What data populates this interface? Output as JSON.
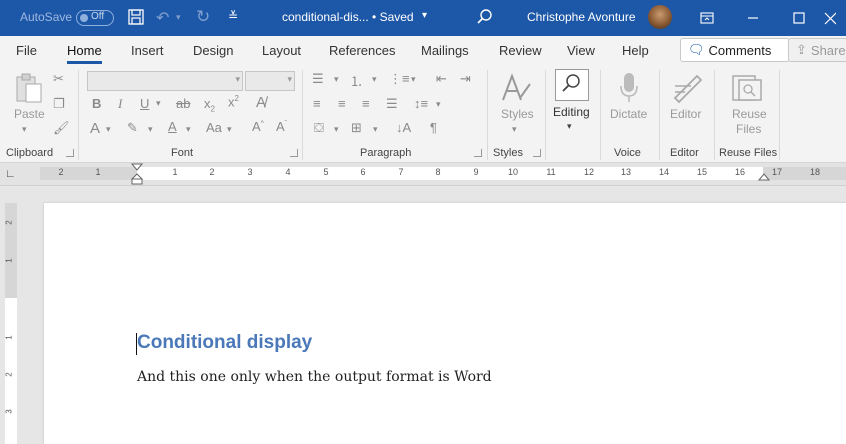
{
  "titlebar": {
    "autosave_label": "AutoSave",
    "autosave_state": "Off",
    "doc_title": "conditional-dis... • Saved",
    "user_name": "Christophe Avonture"
  },
  "menu": {
    "tabs": [
      "File",
      "Home",
      "Insert",
      "Design",
      "Layout",
      "References",
      "Mailings",
      "Review",
      "View",
      "Help"
    ],
    "active_tab": "Home",
    "comments_label": "Comments",
    "share_label": "Share"
  },
  "ribbon": {
    "clipboard": {
      "paste_label": "Paste",
      "group_label": "Clipboard"
    },
    "font": {
      "group_label": "Font"
    },
    "paragraph": {
      "group_label": "Paragraph"
    },
    "styles": {
      "styles_label": "Styles",
      "group_label": "Styles"
    },
    "editing": {
      "editing_label": "Editing"
    },
    "voice": {
      "dictate_label": "Dictate",
      "group_label": "Voice"
    },
    "editor": {
      "editor_label": "Editor",
      "group_label": "Editor"
    },
    "reuse": {
      "reuse_label_1": "Reuse",
      "reuse_label_2": "Files",
      "group_label": "Reuse Files"
    }
  },
  "ruler": {
    "numbers": [
      "2",
      "1",
      "1",
      "2",
      "3",
      "4",
      "5",
      "6",
      "7",
      "8",
      "9",
      "10",
      "11",
      "12",
      "13",
      "14",
      "15",
      "16",
      "17",
      "18"
    ]
  },
  "vruler": {
    "numbers": [
      "2",
      "1",
      "1",
      "2",
      "3"
    ]
  },
  "document": {
    "heading": "Conditional display",
    "body": "And this one only when the output format is Word"
  },
  "colors": {
    "title_bar": "#1d57a8",
    "heading": "#4a78b8",
    "ribbon_bg": "#f3f3f3"
  }
}
